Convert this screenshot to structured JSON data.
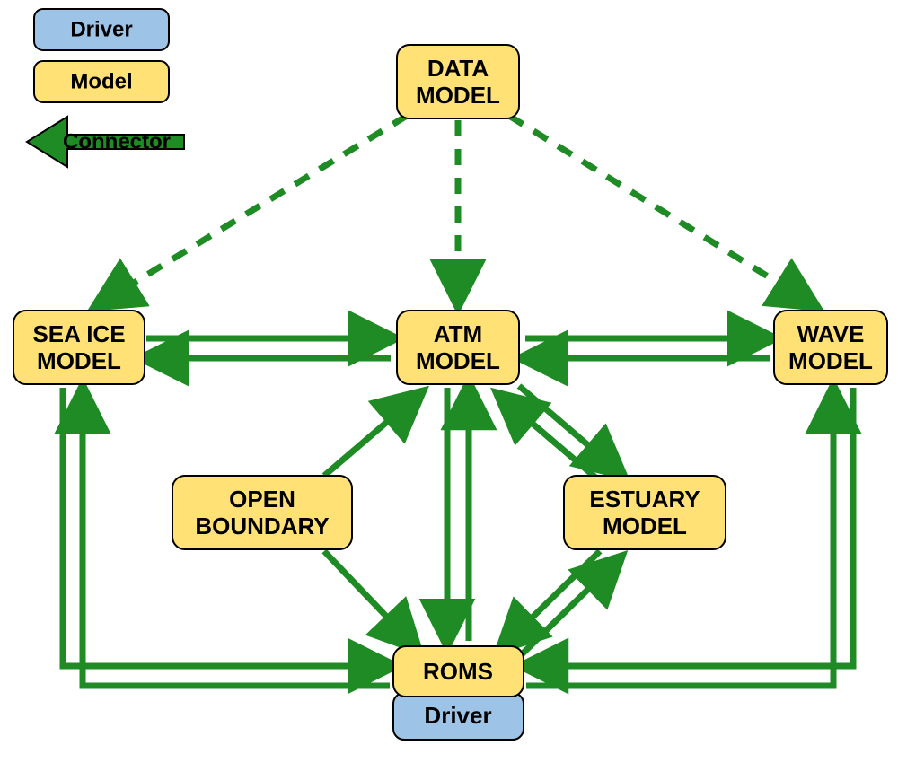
{
  "legend": {
    "driver": "Driver",
    "model": "Model",
    "connector": "Connector"
  },
  "nodes": {
    "data_model": {
      "line1": "DATA",
      "line2": "MODEL"
    },
    "sea_ice": {
      "line1": "SEA ICE",
      "line2": "MODEL"
    },
    "atm": {
      "line1": "ATM",
      "line2": "MODEL"
    },
    "wave": {
      "line1": "WAVE",
      "line2": "MODEL"
    },
    "open_boundary": {
      "line1": "OPEN",
      "line2": "BOUNDARY"
    },
    "estuary": {
      "line1": "ESTUARY",
      "line2": "MODEL"
    },
    "roms": {
      "line1": "ROMS"
    },
    "driver": {
      "line1": "Driver"
    }
  },
  "connections": [
    {
      "from": "data_model",
      "to": "sea_ice",
      "style": "dashed",
      "bidir": false
    },
    {
      "from": "data_model",
      "to": "atm",
      "style": "dashed",
      "bidir": false
    },
    {
      "from": "data_model",
      "to": "wave",
      "style": "dashed",
      "bidir": false
    },
    {
      "from": "sea_ice",
      "to": "atm",
      "style": "solid",
      "bidir": true
    },
    {
      "from": "atm",
      "to": "wave",
      "style": "solid",
      "bidir": true
    },
    {
      "from": "open_boundary",
      "to": "atm",
      "style": "solid",
      "bidir": false
    },
    {
      "from": "open_boundary",
      "to": "roms",
      "style": "solid",
      "bidir": false
    },
    {
      "from": "atm",
      "to": "estuary",
      "style": "solid",
      "bidir": true
    },
    {
      "from": "estuary",
      "to": "roms",
      "style": "solid",
      "bidir": true
    },
    {
      "from": "atm",
      "to": "roms",
      "style": "solid",
      "bidir": true
    },
    {
      "from": "sea_ice",
      "to": "roms",
      "style": "solid",
      "bidir": true
    },
    {
      "from": "wave",
      "to": "roms",
      "style": "solid",
      "bidir": true
    }
  ],
  "colors": {
    "model_fill": "#ffe176",
    "driver_fill": "#9dc3e6",
    "connector": "#1f8b24",
    "stroke": "#000000"
  }
}
